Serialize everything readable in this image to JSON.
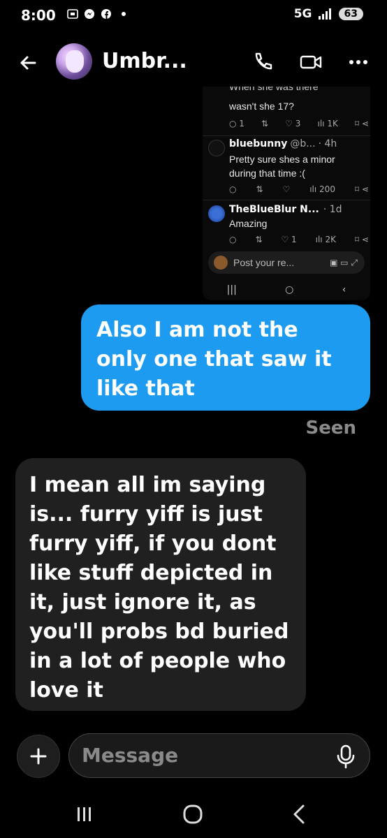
{
  "status_bar": {
    "time": "8:00",
    "network": "5G",
    "battery": "63"
  },
  "header": {
    "contact_name": "Umbr...",
    "icons": [
      "back-arrow-icon",
      "phone-icon",
      "video-icon",
      "more-icon"
    ]
  },
  "shared_screenshot": {
    "top_text": "wasn't she 17?",
    "top_text_clipped": "When she was there",
    "top_stats": {
      "replies": "1",
      "likes": "3",
      "views": "1K"
    },
    "reply1": {
      "user": "bluebunny",
      "handle": "@b...",
      "time": "· 4h",
      "text": "Pretty sure shes a minor during that time :(",
      "views": "200"
    },
    "reply2": {
      "user": "TheBlueBlur N...",
      "time": "· 1d",
      "text": "Amazing",
      "likes": "1",
      "views": "2K"
    },
    "post_reply_placeholder": "Post your re..."
  },
  "messages": {
    "outgoing": "Also I am not the only one that saw it like that",
    "seen_label": "Seen",
    "incoming": "I mean all im saying is... furry yiff is just furry yiff, if you dont like stuff depicted in it, just ignore it, as you'll probs bd buried in a lot of people who love it"
  },
  "composer": {
    "placeholder": "Message"
  },
  "colors": {
    "accent_blue": "#1d9bf0",
    "incoming_bubble": "#202020",
    "background": "#000000"
  }
}
